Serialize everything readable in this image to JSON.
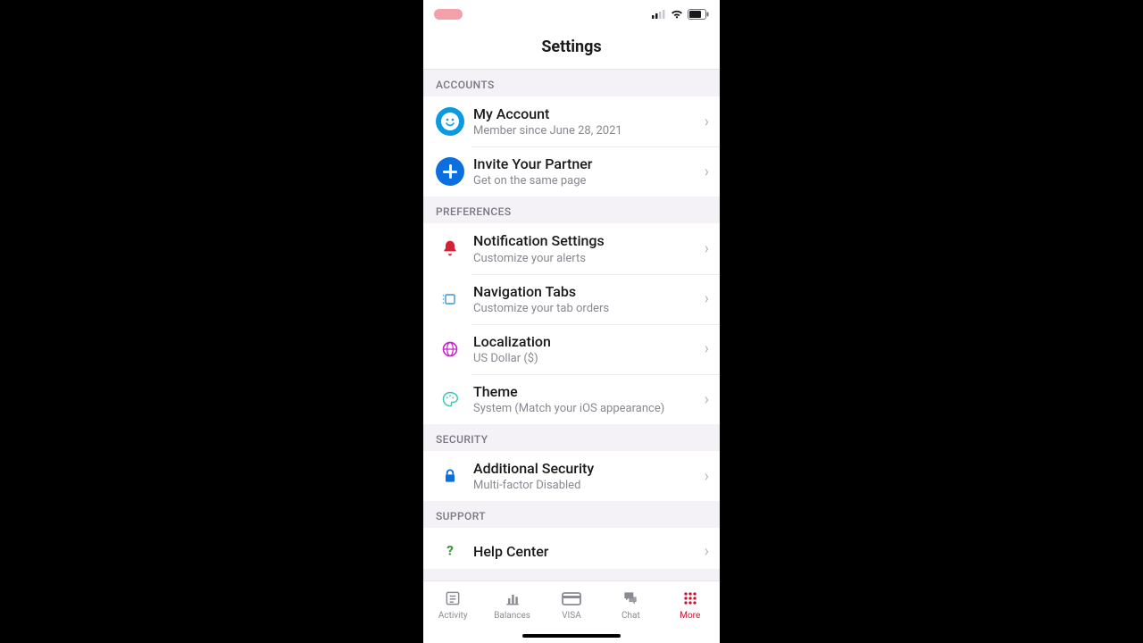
{
  "header": {
    "title": "Settings"
  },
  "sections": {
    "accounts": {
      "label": "ACCOUNTS",
      "my_account": {
        "title": "My Account",
        "sub": "Member since June 28, 2021"
      },
      "invite": {
        "title": "Invite Your Partner",
        "sub": "Get on the same page"
      }
    },
    "preferences": {
      "label": "PREFERENCES",
      "notifications": {
        "title": "Notification Settings",
        "sub": "Customize your alerts"
      },
      "navtabs": {
        "title": "Navigation Tabs",
        "sub": "Customize your tab orders"
      },
      "localization": {
        "title": "Localization",
        "sub": "US Dollar ($)"
      },
      "theme": {
        "title": "Theme",
        "sub": "System (Match your iOS appearance)"
      }
    },
    "security": {
      "label": "SECURITY",
      "additional": {
        "title": "Additional Security",
        "sub": "Multi-factor Disabled"
      }
    },
    "support": {
      "label": "SUPPORT",
      "help": {
        "title": "Help Center"
      }
    }
  },
  "tabs": {
    "activity": "Activity",
    "balances": "Balances",
    "visa": "VISA",
    "chat": "Chat",
    "more": "More"
  }
}
